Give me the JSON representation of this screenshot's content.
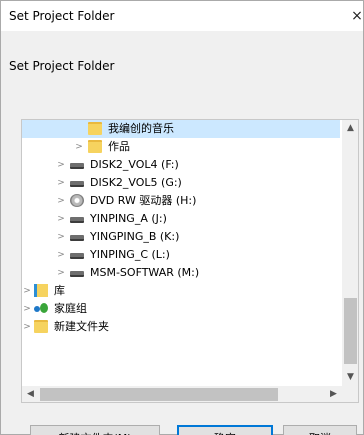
{
  "window": {
    "title": "Set Project Folder",
    "close_glyph": "×"
  },
  "prompt": "Set Project Folder",
  "tree": {
    "items": [
      {
        "label": "我编创的音乐",
        "icon": "folder-icon",
        "selected": true
      },
      {
        "label": "作品",
        "icon": "folder-icon"
      },
      {
        "label": "DISK2_VOL4 (F:)",
        "icon": "drive-icon"
      },
      {
        "label": "DISK2_VOL5 (G:)",
        "icon": "drive-icon"
      },
      {
        "label": "DVD RW 驱动器 (H:)",
        "icon": "dvd-drive-icon"
      },
      {
        "label": "YINPING_A (J:)",
        "icon": "drive-icon"
      },
      {
        "label": "YINGPING_B (K:)",
        "icon": "drive-icon"
      },
      {
        "label": "YINPING_C (L:)",
        "icon": "drive-icon"
      },
      {
        "label": "MSM-SOFTWAR (M:)",
        "icon": "drive-icon"
      },
      {
        "label": "库",
        "icon": "library-icon"
      },
      {
        "label": "家庭组",
        "icon": "homegroup-icon"
      },
      {
        "label": "新建文件夹",
        "icon": "folder-icon"
      }
    ]
  },
  "buttons": {
    "new_folder": "新建文件夹(M)",
    "ok": "确定",
    "cancel": "取消"
  },
  "colors": {
    "selection": "#cce8ff",
    "folder": "#f6d35f",
    "accent": "#0078d7"
  }
}
